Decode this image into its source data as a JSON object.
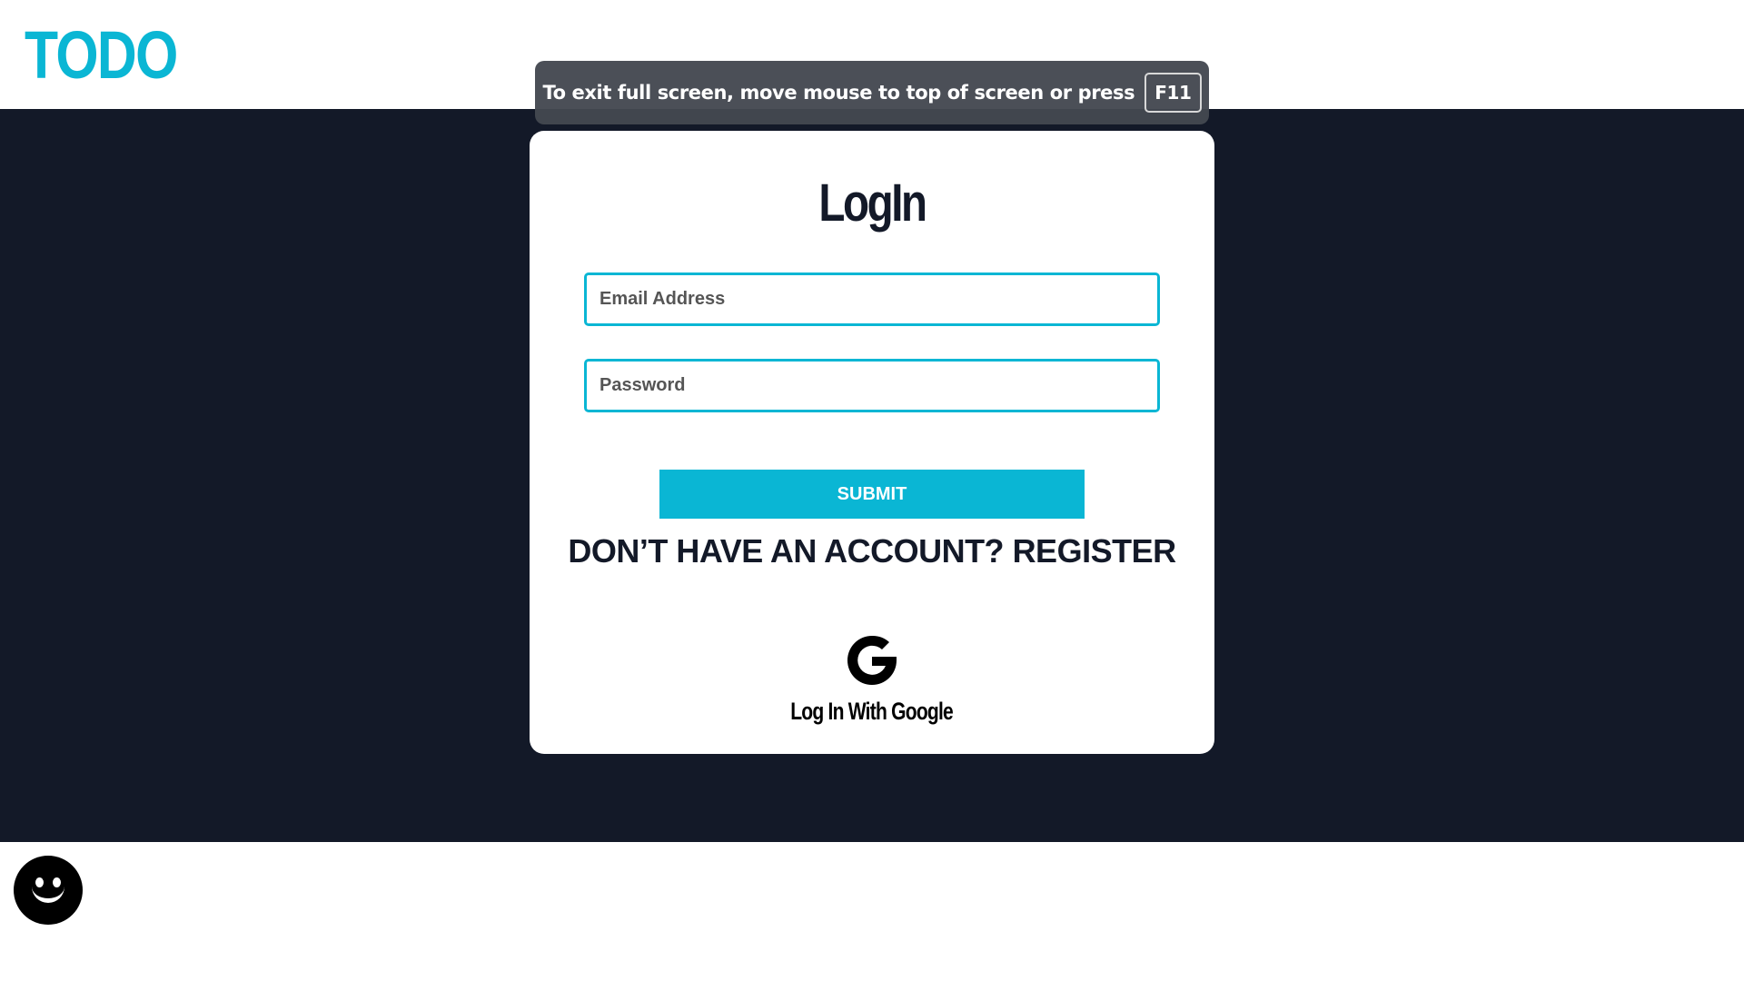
{
  "header": {
    "logo_text": "TODO"
  },
  "fullscreen_banner": {
    "message": "To exit full screen, move mouse to top of screen or press",
    "key": "F11"
  },
  "login": {
    "title": "LogIn",
    "email_placeholder": "Email Address",
    "password_placeholder": "Password",
    "submit_label": "SUBMIT",
    "register_prompt": "DON’T HAVE AN ACCOUNT?",
    "register_link": "REGISTER",
    "google_label": "Log In With Google",
    "google_icon": "google-g-icon"
  },
  "footer": {
    "avatar_icon": "smiley-face-icon"
  },
  "colors": {
    "accent": "#0ab6d4",
    "dark_background": "#131928",
    "card": "#ffffff"
  }
}
